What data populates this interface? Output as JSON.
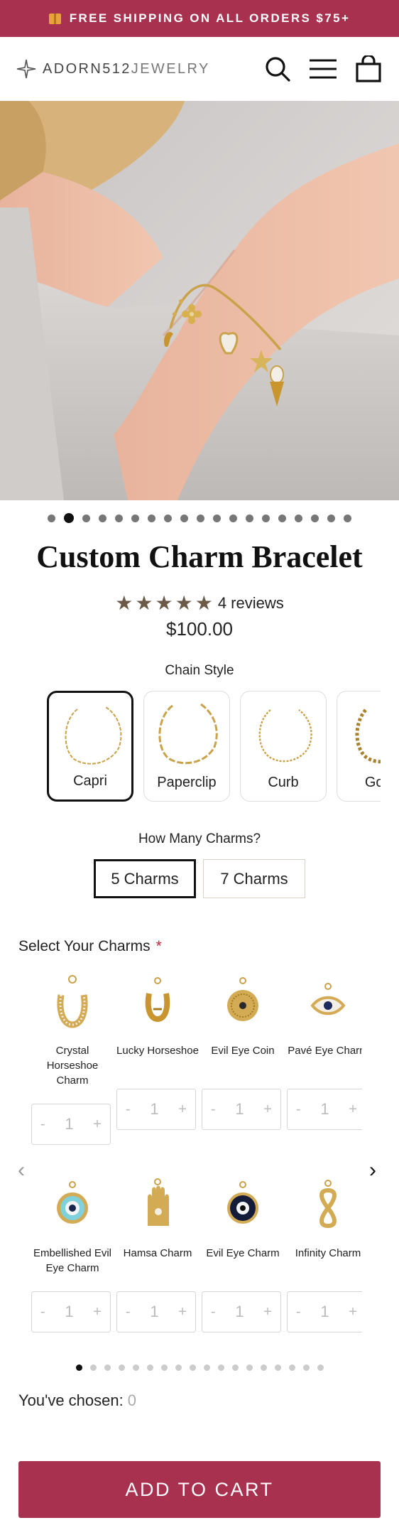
{
  "announcement": {
    "icon": "box-icon",
    "text": "FREE SHIPPING ON ALL ORDERS $75+"
  },
  "header": {
    "logo_main": "ADORN512",
    "logo_sub": "JEWELRY",
    "icons": [
      "search-icon",
      "menu-icon",
      "cart-icon"
    ]
  },
  "gallery": {
    "total_slides": 19,
    "active_index": 1
  },
  "product": {
    "title": "Custom Charm Bracelet",
    "rating": 5,
    "reviews": "4 reviews",
    "price": "$100.00"
  },
  "chain_style": {
    "label": "Chain Style",
    "options": [
      "Capri",
      "Paperclip",
      "Curb",
      "Gold"
    ],
    "selected": "Capri"
  },
  "charm_count": {
    "label": "How Many Charms?",
    "options": [
      "5 Charms",
      "7 Charms"
    ],
    "selected": "5 Charms"
  },
  "charms": {
    "label": "Select Your Charms",
    "required_mark": "*",
    "items": [
      {
        "name": "Crystal Horseshoe Charm",
        "qty": "1",
        "icon": "horseshoe-icon"
      },
      {
        "name": "Lucky Horseshoe",
        "qty": "1",
        "icon": "horseshoe-icon"
      },
      {
        "name": "Evil Eye Coin",
        "qty": "1",
        "icon": "evil-eye-coin-icon"
      },
      {
        "name": "Pavé Eye Charm",
        "qty": "1",
        "icon": "eye-charm-icon"
      },
      {
        "name": "Embellished Evil Eye Charm",
        "qty": "1",
        "icon": "evil-eye-icon"
      },
      {
        "name": "Hamsa Charm",
        "qty": "1",
        "icon": "hamsa-icon"
      },
      {
        "name": "Evil Eye Charm",
        "qty": "1",
        "icon": "evil-eye-icon"
      },
      {
        "name": "Infinity Charm",
        "qty": "1",
        "icon": "infinity-icon"
      }
    ],
    "minus": "-",
    "plus": "+",
    "prev_arrow": "‹",
    "next_arrow": "›",
    "total_pages": 18,
    "active_page": 0
  },
  "chosen": {
    "label": "You've chosen:",
    "count": "0"
  },
  "add_to_cart": "ADD TO CART",
  "colors": {
    "brand": "#a8314f",
    "star": "#6c5a48",
    "gold": "#c9a24a"
  }
}
